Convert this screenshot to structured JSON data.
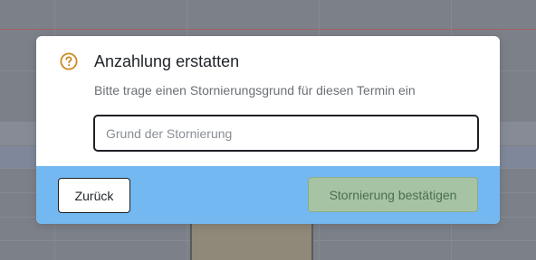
{
  "dialog": {
    "icon": "question-circle-icon",
    "title": "Anzahlung erstatten",
    "subtitle": "Bitte trage einen Stornierungsgrund für diesen Termin ein",
    "reason_input": {
      "value": "",
      "placeholder": "Grund der Stornierung"
    },
    "back_label": "Zurück",
    "confirm_label": "Stornierung bestätigen",
    "confirm_enabled": false
  },
  "colors": {
    "overlay": "#7c8088",
    "footer": "#73b8f0",
    "icon_accent": "#c98a1e",
    "confirm_disabled_bg": "#a6c4a4",
    "confirm_disabled_text": "#4a6d52"
  }
}
